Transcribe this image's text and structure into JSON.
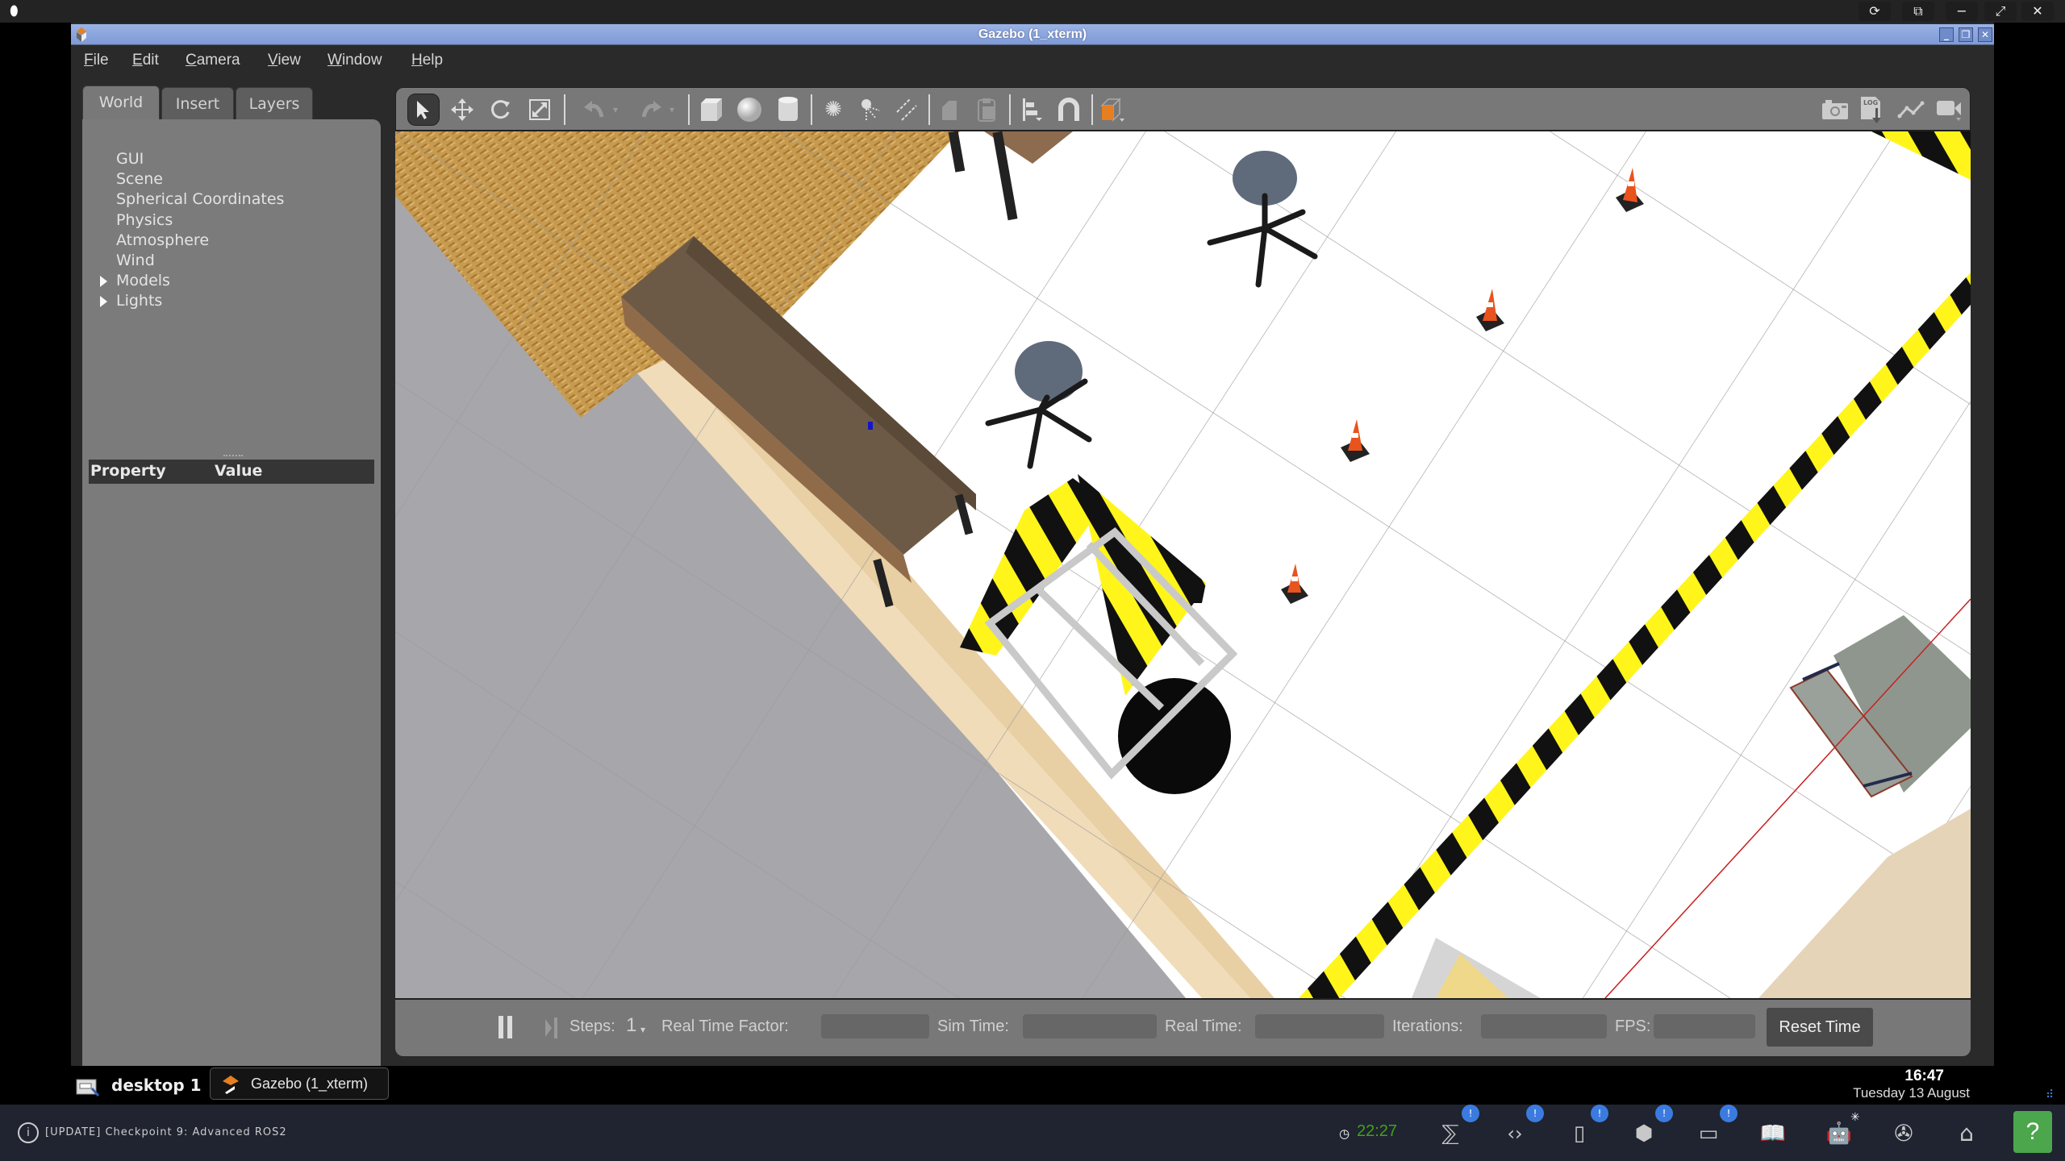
{
  "desktop": {
    "top_controls": [
      "refresh-icon",
      "external-icon",
      "minimize-icon",
      "fullscreen-icon",
      "close-icon"
    ]
  },
  "window": {
    "title": "Gazebo (1_xterm)",
    "controls": {
      "minimize": "_",
      "restore": "❐",
      "close": "✕"
    }
  },
  "menu": [
    "File",
    "Edit",
    "Camera",
    "View",
    "Window",
    "Help"
  ],
  "left_panel": {
    "tabs": [
      {
        "label": "World",
        "active": true
      },
      {
        "label": "Insert",
        "active": false
      },
      {
        "label": "Layers",
        "active": false
      }
    ],
    "tree": [
      {
        "label": "GUI",
        "expandable": false
      },
      {
        "label": "Scene",
        "expandable": false
      },
      {
        "label": "Spherical Coordinates",
        "expandable": false
      },
      {
        "label": "Physics",
        "expandable": false
      },
      {
        "label": "Atmosphere",
        "expandable": false
      },
      {
        "label": "Wind",
        "expandable": false
      },
      {
        "label": "Models",
        "expandable": true
      },
      {
        "label": "Lights",
        "expandable": true
      }
    ],
    "property_header": {
      "property": "Property",
      "value": "Value"
    }
  },
  "toolbar": {
    "tools": [
      "select-mode-icon",
      "translate-mode-icon",
      "rotate-mode-icon",
      "scale-mode-icon",
      "undo-icon",
      "undo-dropdown-icon",
      "redo-icon",
      "redo-dropdown-icon",
      "box-shape-icon",
      "sphere-shape-icon",
      "cylinder-shape-icon",
      "point-light-icon",
      "spot-light-icon",
      "directional-light-icon",
      "copy-icon",
      "paste-icon",
      "align-icon",
      "snap-magnet-icon",
      "view-angle-icon"
    ],
    "right_tools": [
      "screenshot-camera-icon",
      "log-icon",
      "plot-icon",
      "video-record-icon"
    ],
    "accent_color": "#e67e22"
  },
  "bottom_bar": {
    "steps_label": "Steps:",
    "steps_value": "1",
    "rtf_label": "Real Time Factor:",
    "rtf_value": "",
    "sim_time_label": "Sim Time:",
    "sim_time_value": "",
    "real_time_label": "Real Time:",
    "real_time_value": "",
    "iterations_label": "Iterations:",
    "iterations_value": "",
    "fps_label": "FPS:",
    "fps_value": "",
    "reset_time": "Reset Time"
  },
  "taskbar": {
    "desktop_label": "desktop 1",
    "window_button": "Gazebo (1_xterm)",
    "clock_time": "16:47",
    "clock_date": "Tuesday 13 August"
  },
  "dock": {
    "notification": "[UPDATE] Checkpoint 9: Advanced ROS2",
    "timer": "22:27",
    "timer_color": "#3fa31a",
    "badge_text": "!",
    "help_label": "?",
    "help_color": "#4ca64c"
  }
}
